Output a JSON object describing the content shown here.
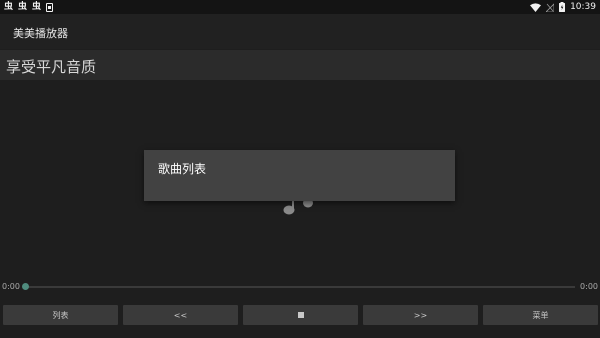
{
  "status_bar": {
    "notification_icons": [
      "虫",
      "虫",
      "虫"
    ],
    "time": "10:39",
    "icons": [
      "wifi-icon",
      "signal-off-icon",
      "battery-icon"
    ]
  },
  "app_bar": {
    "title": "美美播放器"
  },
  "subtitle": {
    "text": "享受平凡音质"
  },
  "dialog": {
    "title": "歌曲列表"
  },
  "player": {
    "elapsed": "0:00",
    "duration": "0:00",
    "progress_fraction": 0
  },
  "controls": {
    "list_label": "列表",
    "prev_label": "<<",
    "stop_icon": "stop-icon",
    "next_label": ">>",
    "menu_label": "菜单"
  },
  "colors": {
    "background": "#1e1e1e",
    "dialog": "#424242",
    "seek_thumb": "#4f8c7e",
    "button": "#3a3a3a"
  }
}
